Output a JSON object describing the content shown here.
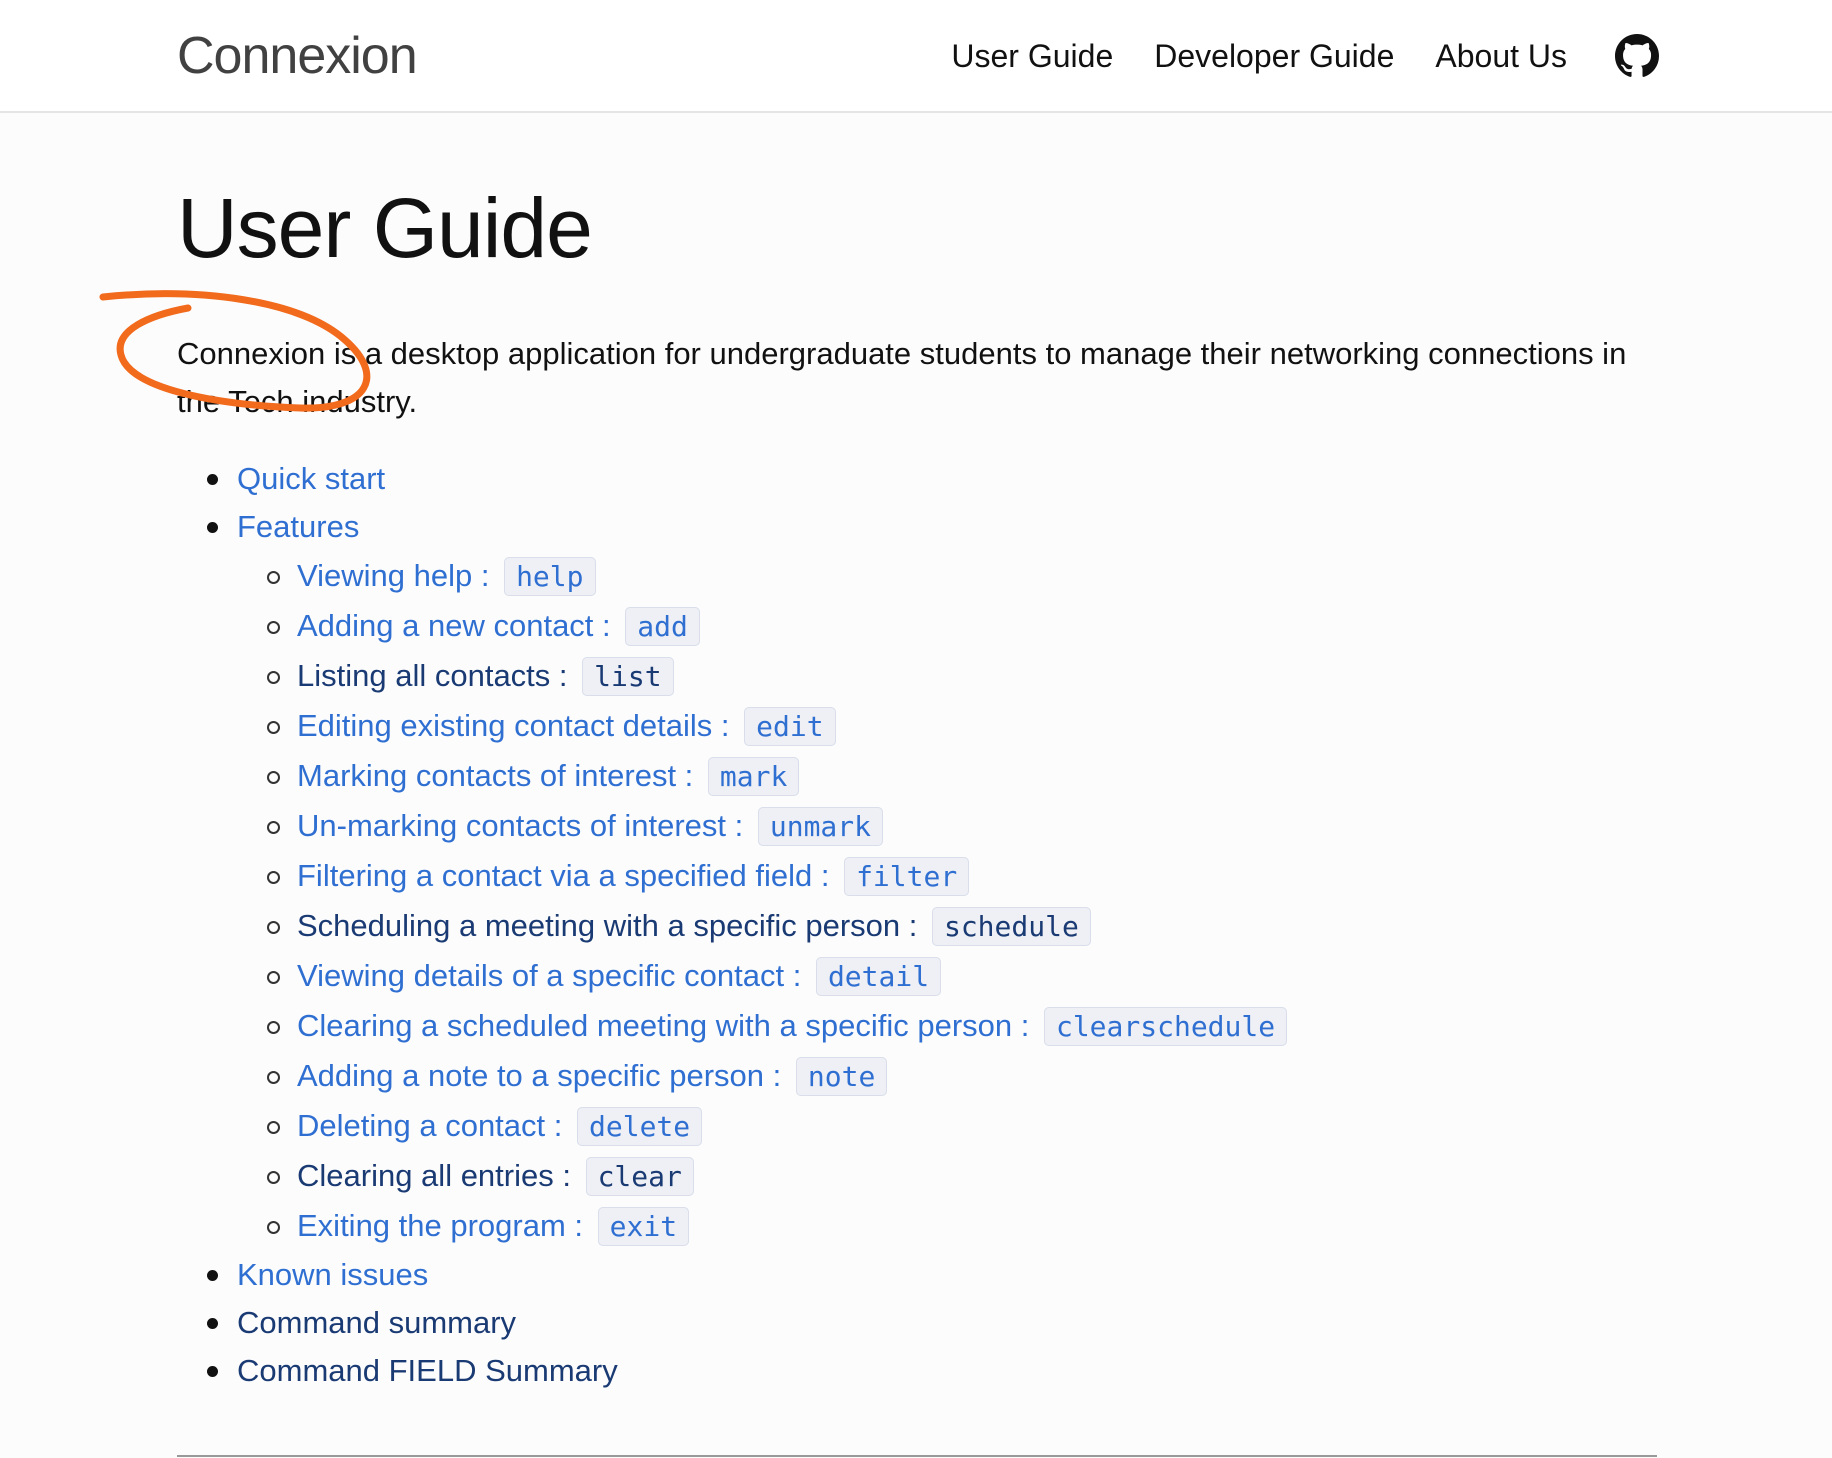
{
  "header": {
    "site_title": "Connexion",
    "nav": [
      "User Guide",
      "Developer Guide",
      "About Us"
    ],
    "github_icon": "github-icon"
  },
  "page": {
    "title": "User Guide",
    "intro": "Connexion is a desktop application for undergraduate students to manage their networking connections in the Tech industry."
  },
  "toc": {
    "top": [
      {
        "label": "Quick start"
      },
      {
        "label": "Features"
      }
    ],
    "features": [
      {
        "label": "Viewing help",
        "cmd": "help"
      },
      {
        "label": "Adding a new contact",
        "cmd": "add"
      },
      {
        "label": "Listing all contacts",
        "cmd": "list"
      },
      {
        "label": "Editing existing contact details",
        "cmd": "edit"
      },
      {
        "label": "Marking contacts of interest",
        "cmd": "mark"
      },
      {
        "label": "Un-marking contacts of interest",
        "cmd": "unmark"
      },
      {
        "label": "Filtering a contact via a specified field",
        "cmd": "filter"
      },
      {
        "label": "Scheduling a meeting with a specific person",
        "cmd": "schedule"
      },
      {
        "label": "Viewing details of a specific contact",
        "cmd": "detail"
      },
      {
        "label": "Clearing a scheduled meeting with a specific person",
        "cmd": "clearschedule"
      },
      {
        "label": "Adding a note to a specific person",
        "cmd": "note"
      },
      {
        "label": "Deleting a contact",
        "cmd": "delete"
      },
      {
        "label": "Clearing all entries",
        "cmd": "clear"
      },
      {
        "label": "Exiting the program",
        "cmd": "exit"
      }
    ],
    "bottom": [
      {
        "label": "Known issues"
      },
      {
        "label": "Command summary"
      },
      {
        "label": "Command FIELD Summary"
      }
    ],
    "separator": " : "
  },
  "colors": {
    "link": "#2f6fd1",
    "visited_link": "#1a3a73",
    "annotation": "#f26a1b"
  }
}
